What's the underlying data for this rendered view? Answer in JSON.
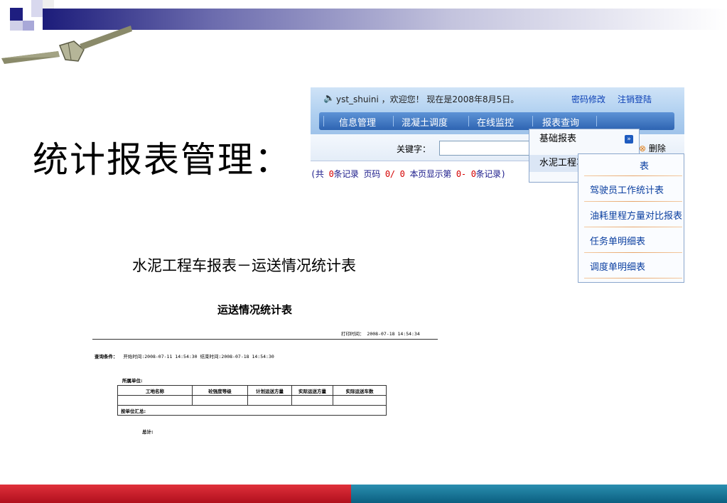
{
  "slide": {
    "title": "统计报表管理：",
    "subtitle": "水泥工程车报表－运送情况统计表"
  },
  "app": {
    "welcome": "yst_shuini ，欢迎您！ 现在是2008年8月5日。",
    "change_password": "密码修改",
    "logout": "注销登陆",
    "nav": [
      "信息管理",
      "混凝土调度",
      "在线监控",
      "报表查询"
    ],
    "keyword_label": "关键字：",
    "delete_label": "删除",
    "records": {
      "p1": "(共 ",
      "count": "0",
      "p2": "条记录 页码 ",
      "page": "0/ 0",
      "p3": " 本页显示第 ",
      "range": "0- 0",
      "p4": "条记录)"
    },
    "menu": [
      "基础报表",
      "水泥工程车报表"
    ],
    "submenu": [
      "运送情况统计表",
      "驾驶员工作统计表",
      "油耗里程方量对比报表",
      "任务单明细表",
      "调度单明细表"
    ],
    "submenu_visible_tail": "表"
  },
  "report": {
    "title": "运送情况统计表",
    "print_time": "打印时间： 2008-07-18 14:54:34",
    "query_label": "查询条件：",
    "query_value": "开始时间:2008-07-11 14:54:30  结束时间:2008-07-18 14:54:30",
    "unit_label": "所属单位:",
    "columns": [
      "工地名称",
      "砼强度等级",
      "计划运送方量",
      "实际运送方量",
      "实际运送车数"
    ],
    "subtotal_label": "按单位汇总:",
    "total_label": "总计:"
  },
  "colors": {
    "nav_blue": "#2e64b2",
    "link_blue": "#0b3fb5",
    "footer_red": "#c01826",
    "footer_teal": "#0b6f90"
  }
}
